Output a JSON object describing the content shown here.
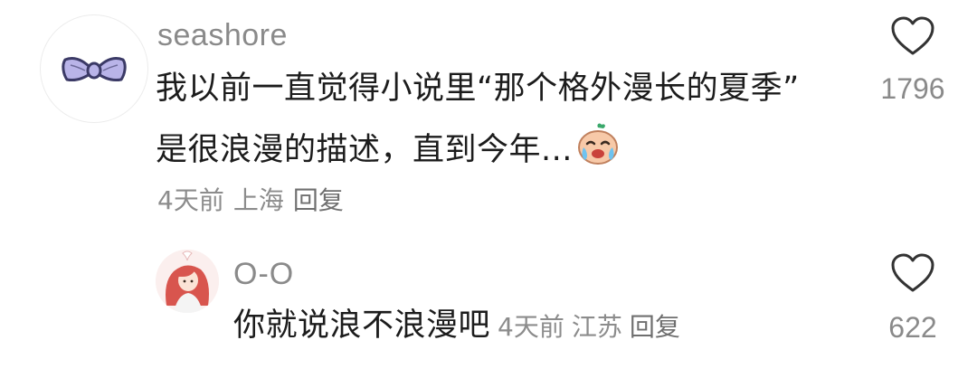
{
  "comments": [
    {
      "username": "seashore",
      "avatar_icon": "bow-icon",
      "text_line1": "我以前一直觉得小说里“那个格外漫长的夏季”",
      "text_line2": "是很浪漫的描述，直到今年...",
      "emoji_icon": "crying-face-emoji",
      "time": "4天前",
      "location": "上海",
      "reply_label": "回复",
      "like_icon": "heart-outline-icon",
      "likes": "1796"
    },
    {
      "username": "O-O",
      "avatar_icon": "girl-illustration-avatar",
      "text": "你就说浪不浪漫吧",
      "time": "4天前",
      "location": "江苏",
      "reply_label": "回复",
      "like_icon": "heart-outline-icon",
      "likes": "622"
    }
  ],
  "colors": {
    "muted_text": "#8a8a8a",
    "body_text": "#1c1c1c",
    "background": "#ffffff"
  }
}
